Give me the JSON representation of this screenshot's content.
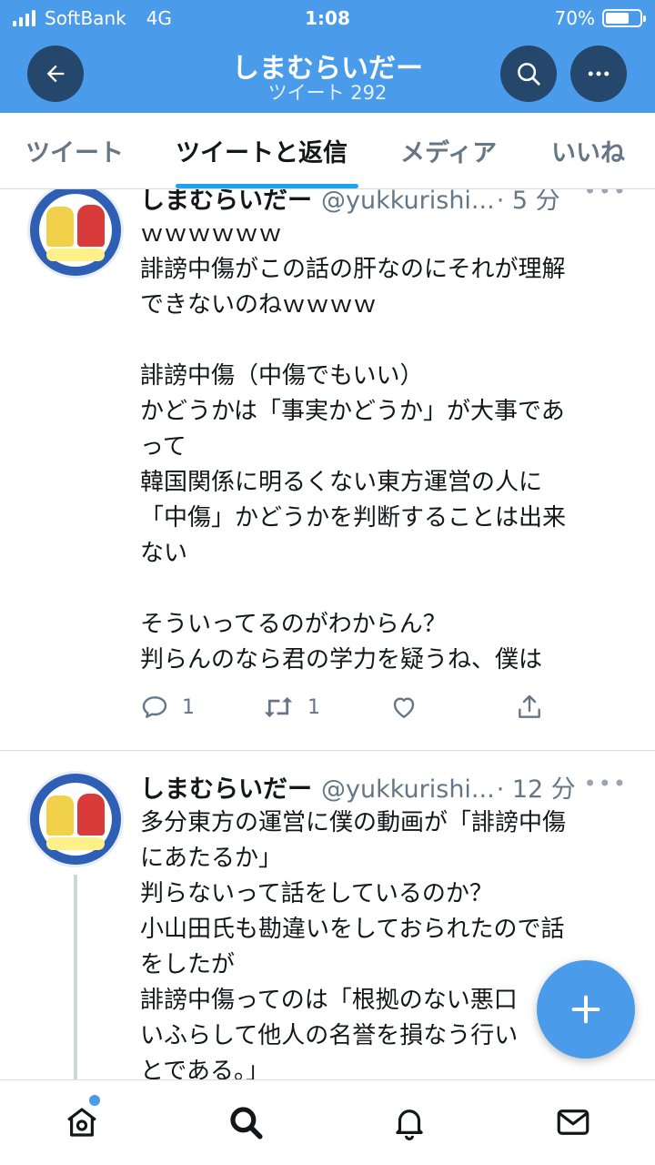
{
  "status_bar": {
    "carrier": "SoftBank",
    "network": "4G",
    "time": "1:08",
    "battery": "70%",
    "battery_level": 0.7
  },
  "header": {
    "title": "しまむらいだー",
    "subtitle": "ツイート 292"
  },
  "icons": {
    "back": "arrow-left-icon",
    "search": "search-icon",
    "more": "more-horizontal-icon",
    "reply": "reply-icon",
    "retweet": "retweet-icon",
    "like": "heart-icon",
    "share": "share-icon",
    "compose": "plus-icon",
    "home": "home-icon",
    "explore": "search-icon",
    "notifications": "bell-icon",
    "messages": "mail-icon"
  },
  "tabs": [
    {
      "label": "ツイート"
    },
    {
      "label": "ツイートと返信"
    },
    {
      "label": "メディア"
    },
    {
      "label": "いいね"
    }
  ],
  "active_tab": "ツイートと返信",
  "tweets": [
    {
      "name": "しまむらいだー",
      "handle": "@yukkurishi...",
      "time": "· 5 分",
      "lines": [
        "ｗｗｗｗｗｗ",
        "誹謗中傷がこの話の肝なのにそれが理解",
        "できないのねｗｗｗｗ",
        "",
        "誹謗中傷（中傷でもいい）",
        "かどうかは「事実かどうか」が大事であ",
        "って",
        "韓国関係に明るくない東方運営の人に",
        "「中傷」かどうかを判断することは出来",
        "ない",
        "",
        "そういってるのがわからん？",
        "判らんのなら君の学力を疑うね、僕は"
      ],
      "replies": "1",
      "retweets": "1"
    },
    {
      "name": "しまむらいだー",
      "handle": "@yukkurishi...",
      "time": "· 12 分",
      "lines": [
        "多分東方の運営に僕の動画が「誹謗中傷",
        "にあたるか」",
        "判らないって話をしているのか？",
        "小山田氏も勘違いをしておられたので話",
        "をしたが",
        "誹謗中傷ってのは「根拠のない悪口",
        "いふらして他人の名誉を損なう行い",
        "とである。」"
      ]
    }
  ],
  "colors": {
    "brand": "#4a9bea",
    "header_btn": "#24476b",
    "accent": "#1da1f2",
    "muted": "#657786"
  }
}
